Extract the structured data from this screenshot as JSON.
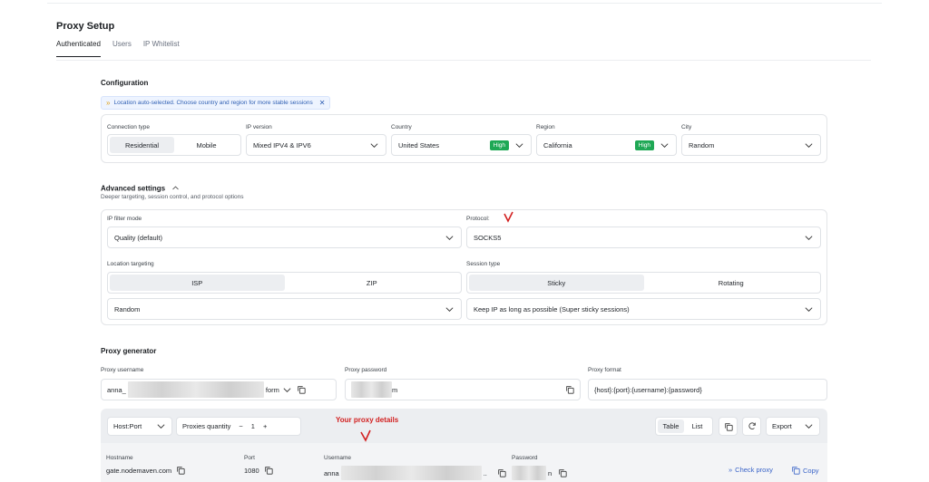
{
  "page": {
    "title": "Proxy Setup"
  },
  "tabs": [
    {
      "label": "Authenticated",
      "active": true
    },
    {
      "label": "Users",
      "active": false
    },
    {
      "label": "IP Whitelist",
      "active": false
    }
  ],
  "configuration": {
    "title": "Configuration",
    "notice": "Location auto-selected. Choose country and region for more stable sessions",
    "connection_type": {
      "label": "Connection type",
      "options": [
        "Residential",
        "Mobile"
      ],
      "selected": "Residential"
    },
    "ip_version": {
      "label": "IP version",
      "value": "Mixed IPV4 & IPV6"
    },
    "country": {
      "label": "Country",
      "value": "United States",
      "badge": "High"
    },
    "region": {
      "label": "Region",
      "value": "California",
      "badge": "High"
    },
    "city": {
      "label": "City",
      "value": "Random"
    }
  },
  "advanced": {
    "title": "Advanced settings",
    "subtitle": "Deeper targeting, session control, and protocol options",
    "ip_filter_mode": {
      "label": "IP filter mode",
      "value": "Quality (default)"
    },
    "protocol": {
      "label": "Protocol:",
      "value": "SOCKS5"
    },
    "location_targeting": {
      "label": "Location targeting",
      "options": [
        "ISP",
        "ZIP"
      ],
      "selected": "ISP",
      "value": "Random"
    },
    "session_type": {
      "label": "Session type",
      "options": [
        "Sticky",
        "Rotating"
      ],
      "selected": "Sticky",
      "value": "Keep IP as long as possible (Super sticky sessions)"
    }
  },
  "generator": {
    "title": "Proxy generator",
    "username": {
      "label": "Proxy username",
      "prefix": "anna_",
      "suffix": "form"
    },
    "password": {
      "label": "Proxy password",
      "suffix": "m"
    },
    "format": {
      "label": "Proxy format",
      "value": "{host}:{port}:{username}:{password}"
    },
    "toolbar": {
      "host_port": "Host:Port",
      "quantity_label": "Proxies quantity",
      "quantity_minus": "−",
      "quantity": "1",
      "quantity_plus": "+",
      "view_table": "Table",
      "view_list": "List",
      "export": "Export"
    },
    "columns": {
      "hostname": "Hostname",
      "port": "Port",
      "username": "Username",
      "password": "Password"
    },
    "row": {
      "hostname": "gate.nodemaven.com",
      "port": "1080",
      "username_prefix": "anna",
      "username_suffix": "..",
      "password_suffix": "n"
    },
    "actions": {
      "check": "Check proxy",
      "copy": "Copy"
    }
  },
  "annotation": {
    "text": "Your proxy details",
    "color": "#d22020"
  },
  "colors": {
    "badge_high": "#1fa855",
    "link": "#3a64c8",
    "notice": "#2f5fb3"
  }
}
